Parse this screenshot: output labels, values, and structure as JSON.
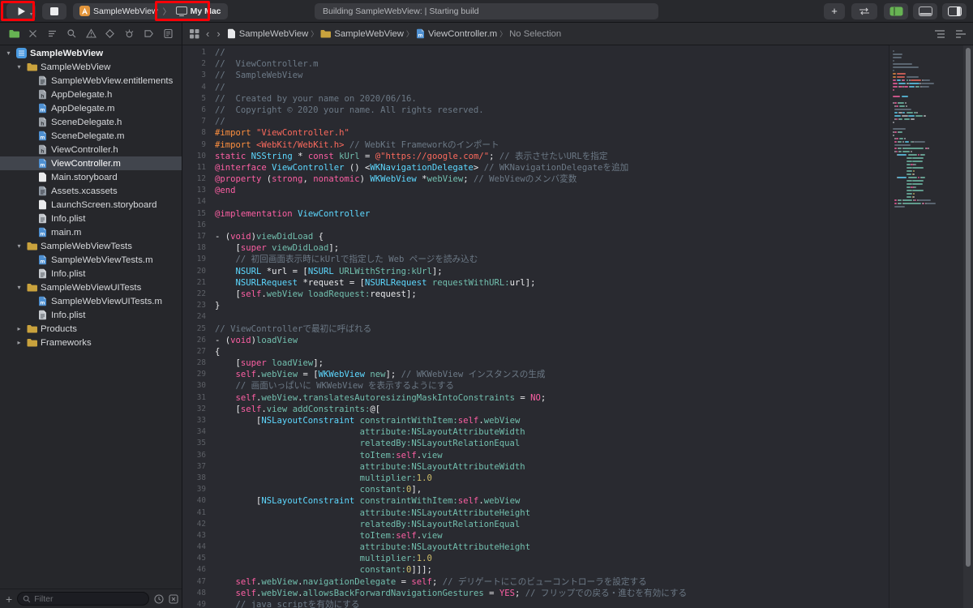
{
  "toolbar": {
    "scheme_app": "SampleWebView",
    "scheme_destination": "My Mac",
    "status": "Building SampleWebView:  | Starting build"
  },
  "jumpbar": {
    "items": [
      {
        "icon": "file-plain",
        "label": "SampleWebView"
      },
      {
        "icon": "folder",
        "label": "SampleWebView"
      },
      {
        "icon": "file-m",
        "label": "ViewController.m"
      },
      {
        "icon": "",
        "label": "No Selection"
      }
    ]
  },
  "sidebar": {
    "nav_icons": [
      "project",
      "source-control",
      "symbols",
      "search",
      "issues",
      "tests",
      "debug",
      "breakpoints",
      "reports"
    ],
    "active_nav": 0,
    "filter_placeholder": "Filter",
    "tree": [
      {
        "level": 0,
        "icon": "project",
        "label": "SampleWebView",
        "expanded": true,
        "bold": true
      },
      {
        "level": 1,
        "icon": "folder",
        "label": "SampleWebView",
        "expanded": true
      },
      {
        "level": 2,
        "icon": "entitlements",
        "label": "SampleWebView.entitlements"
      },
      {
        "level": 2,
        "icon": "file-h",
        "label": "AppDelegate.h"
      },
      {
        "level": 2,
        "icon": "file-m",
        "label": "AppDelegate.m"
      },
      {
        "level": 2,
        "icon": "file-h",
        "label": "SceneDelegate.h"
      },
      {
        "level": 2,
        "icon": "file-m",
        "label": "SceneDelegate.m"
      },
      {
        "level": 2,
        "icon": "file-h",
        "label": "ViewController.h"
      },
      {
        "level": 2,
        "icon": "file-m",
        "label": "ViewController.m",
        "selected": true
      },
      {
        "level": 2,
        "icon": "storyboard",
        "label": "Main.storyboard"
      },
      {
        "level": 2,
        "icon": "xcassets",
        "label": "Assets.xcassets"
      },
      {
        "level": 2,
        "icon": "storyboard",
        "label": "LaunchScreen.storyboard"
      },
      {
        "level": 2,
        "icon": "plist",
        "label": "Info.plist"
      },
      {
        "level": 2,
        "icon": "file-m",
        "label": "main.m"
      },
      {
        "level": 1,
        "icon": "folder",
        "label": "SampleWebViewTests",
        "expanded": true
      },
      {
        "level": 2,
        "icon": "file-m",
        "label": "SampleWebViewTests.m"
      },
      {
        "level": 2,
        "icon": "plist",
        "label": "Info.plist"
      },
      {
        "level": 1,
        "icon": "folder",
        "label": "SampleWebViewUITests",
        "expanded": true
      },
      {
        "level": 2,
        "icon": "file-m",
        "label": "SampleWebViewUITests.m"
      },
      {
        "level": 2,
        "icon": "plist",
        "label": "Info.plist"
      },
      {
        "level": 1,
        "icon": "folder",
        "label": "Products",
        "expanded": false
      },
      {
        "level": 1,
        "icon": "folder",
        "label": "Frameworks",
        "expanded": false
      }
    ]
  },
  "editor": {
    "lines": [
      [
        [
          "c",
          "//"
        ]
      ],
      [
        [
          "c",
          "//  ViewController.m"
        ]
      ],
      [
        [
          "c",
          "//  SampleWebView"
        ]
      ],
      [
        [
          "c",
          "//"
        ]
      ],
      [
        [
          "c",
          "//  Created by your name on 2020/06/16."
        ]
      ],
      [
        [
          "c",
          "//  Copyright © 2020 your name. All rights reserved."
        ]
      ],
      [
        [
          "c",
          "//"
        ]
      ],
      [
        [
          "d",
          "#import "
        ],
        [
          "s",
          "\"ViewController.h\""
        ]
      ],
      [
        [
          "d",
          "#import "
        ],
        [
          "s",
          "<WebKit/WebKit.h>"
        ],
        [
          "p",
          " "
        ],
        [
          "c",
          "// WebKit Frameworkのインポート"
        ]
      ],
      [
        [
          "k",
          "static"
        ],
        [
          "p",
          " "
        ],
        [
          "t",
          "NSString"
        ],
        [
          "p",
          " * "
        ],
        [
          "k",
          "const"
        ],
        [
          "p",
          " "
        ],
        [
          "m",
          "kUrl"
        ],
        [
          "p",
          " = "
        ],
        [
          "s",
          "@\"https://google.com/\""
        ],
        [
          "p",
          "; "
        ],
        [
          "c",
          "// 表示させたいURLを指定"
        ]
      ],
      [
        [
          "k",
          "@interface"
        ],
        [
          "p",
          " "
        ],
        [
          "t",
          "ViewController"
        ],
        [
          "p",
          " () <"
        ],
        [
          "t",
          "WKNavigationDelegate"
        ],
        [
          "p",
          "> "
        ],
        [
          "c",
          "// WKNavigationDelegateを追加"
        ]
      ],
      [
        [
          "k",
          "@property"
        ],
        [
          "p",
          " ("
        ],
        [
          "k",
          "strong"
        ],
        [
          "p",
          ", "
        ],
        [
          "k",
          "nonatomic"
        ],
        [
          "p",
          ") "
        ],
        [
          "t",
          "WKWebView"
        ],
        [
          "p",
          " *"
        ],
        [
          "m",
          "webView"
        ],
        [
          "p",
          "; "
        ],
        [
          "c",
          "// WebViewのメンバ変数"
        ]
      ],
      [
        [
          "k",
          "@end"
        ]
      ],
      [],
      [
        [
          "k",
          "@implementation"
        ],
        [
          "p",
          " "
        ],
        [
          "t",
          "ViewController"
        ]
      ],
      [],
      [
        [
          "p",
          "- ("
        ],
        [
          "k",
          "void"
        ],
        [
          "p",
          ")"
        ],
        [
          "m",
          "viewDidLoad"
        ],
        [
          "p",
          " {"
        ]
      ],
      [
        [
          "p",
          "    ["
        ],
        [
          "k",
          "super"
        ],
        [
          "p",
          " "
        ],
        [
          "m",
          "viewDidLoad"
        ],
        [
          "p",
          "];"
        ]
      ],
      [
        [
          "c",
          "    // 初回画面表示時にkUrlで指定した Web ページを読み込む"
        ]
      ],
      [
        [
          "p",
          "    "
        ],
        [
          "t",
          "NSURL"
        ],
        [
          "p",
          " *url = ["
        ],
        [
          "t",
          "NSURL"
        ],
        [
          "p",
          " "
        ],
        [
          "m",
          "URLWithString:"
        ],
        [
          "m",
          "kUrl"
        ],
        [
          "p",
          "];"
        ]
      ],
      [
        [
          "p",
          "    "
        ],
        [
          "t",
          "NSURLRequest"
        ],
        [
          "p",
          " *request = ["
        ],
        [
          "t",
          "NSURLRequest"
        ],
        [
          "p",
          " "
        ],
        [
          "m",
          "requestWithURL:"
        ],
        [
          "p",
          "url];"
        ]
      ],
      [
        [
          "p",
          "    ["
        ],
        [
          "k",
          "self"
        ],
        [
          "p",
          "."
        ],
        [
          "m",
          "webView"
        ],
        [
          "p",
          " "
        ],
        [
          "m",
          "loadRequest:"
        ],
        [
          "p",
          "request];"
        ]
      ],
      [
        [
          "p",
          "}"
        ]
      ],
      [],
      [
        [
          "c",
          "// ViewControllerで最初に呼ばれる"
        ]
      ],
      [
        [
          "p",
          "- ("
        ],
        [
          "k",
          "void"
        ],
        [
          "p",
          ")"
        ],
        [
          "m",
          "loadView"
        ]
      ],
      [
        [
          "p",
          "{"
        ]
      ],
      [
        [
          "p",
          "    ["
        ],
        [
          "k",
          "super"
        ],
        [
          "p",
          " "
        ],
        [
          "m",
          "loadView"
        ],
        [
          "p",
          "];"
        ]
      ],
      [
        [
          "p",
          "    "
        ],
        [
          "k",
          "self"
        ],
        [
          "p",
          "."
        ],
        [
          "m",
          "webView"
        ],
        [
          "p",
          " = ["
        ],
        [
          "t",
          "WKWebView"
        ],
        [
          "p",
          " "
        ],
        [
          "m",
          "new"
        ],
        [
          "p",
          "]; "
        ],
        [
          "c",
          "// WKWebView インスタンスの生成"
        ]
      ],
      [
        [
          "c",
          "    // 画面いっぱいに WKWebView を表示するようにする"
        ]
      ],
      [
        [
          "p",
          "    "
        ],
        [
          "k",
          "self"
        ],
        [
          "p",
          "."
        ],
        [
          "m",
          "webView"
        ],
        [
          "p",
          "."
        ],
        [
          "m",
          "translatesAutoresizingMaskIntoConstraints"
        ],
        [
          "p",
          " = "
        ],
        [
          "k",
          "NO"
        ],
        [
          "p",
          ";"
        ]
      ],
      [
        [
          "p",
          "    ["
        ],
        [
          "k",
          "self"
        ],
        [
          "p",
          "."
        ],
        [
          "m",
          "view"
        ],
        [
          "p",
          " "
        ],
        [
          "m",
          "addConstraints:"
        ],
        [
          "p",
          "@["
        ]
      ],
      [
        [
          "p",
          "        ["
        ],
        [
          "t",
          "NSLayoutConstraint"
        ],
        [
          "p",
          " "
        ],
        [
          "m",
          "constraintWithItem:"
        ],
        [
          "k",
          "self"
        ],
        [
          "p",
          "."
        ],
        [
          "m",
          "webView"
        ]
      ],
      [
        [
          "p",
          "                            "
        ],
        [
          "m",
          "attribute:"
        ],
        [
          "m",
          "NSLayoutAttributeWidth"
        ]
      ],
      [
        [
          "p",
          "                            "
        ],
        [
          "m",
          "relatedBy:"
        ],
        [
          "m",
          "NSLayoutRelationEqual"
        ]
      ],
      [
        [
          "p",
          "                            "
        ],
        [
          "m",
          "toItem:"
        ],
        [
          "k",
          "self"
        ],
        [
          "p",
          "."
        ],
        [
          "m",
          "view"
        ]
      ],
      [
        [
          "p",
          "                            "
        ],
        [
          "m",
          "attribute:"
        ],
        [
          "m",
          "NSLayoutAttributeWidth"
        ]
      ],
      [
        [
          "p",
          "                            "
        ],
        [
          "m",
          "multiplier:"
        ],
        [
          "n",
          "1.0"
        ]
      ],
      [
        [
          "p",
          "                            "
        ],
        [
          "m",
          "constant:"
        ],
        [
          "n",
          "0"
        ],
        [
          "p",
          "],"
        ]
      ],
      [
        [
          "p",
          "        ["
        ],
        [
          "t",
          "NSLayoutConstraint"
        ],
        [
          "p",
          " "
        ],
        [
          "m",
          "constraintWithItem:"
        ],
        [
          "k",
          "self"
        ],
        [
          "p",
          "."
        ],
        [
          "m",
          "webView"
        ]
      ],
      [
        [
          "p",
          "                            "
        ],
        [
          "m",
          "attribute:"
        ],
        [
          "m",
          "NSLayoutAttributeHeight"
        ]
      ],
      [
        [
          "p",
          "                            "
        ],
        [
          "m",
          "relatedBy:"
        ],
        [
          "m",
          "NSLayoutRelationEqual"
        ]
      ],
      [
        [
          "p",
          "                            "
        ],
        [
          "m",
          "toItem:"
        ],
        [
          "k",
          "self"
        ],
        [
          "p",
          "."
        ],
        [
          "m",
          "view"
        ]
      ],
      [
        [
          "p",
          "                            "
        ],
        [
          "m",
          "attribute:"
        ],
        [
          "m",
          "NSLayoutAttributeHeight"
        ]
      ],
      [
        [
          "p",
          "                            "
        ],
        [
          "m",
          "multiplier:"
        ],
        [
          "n",
          "1.0"
        ]
      ],
      [
        [
          "p",
          "                            "
        ],
        [
          "m",
          "constant:"
        ],
        [
          "n",
          "0"
        ],
        [
          "p",
          "]]];"
        ]
      ],
      [
        [
          "p",
          "    "
        ],
        [
          "k",
          "self"
        ],
        [
          "p",
          "."
        ],
        [
          "m",
          "webView"
        ],
        [
          "p",
          "."
        ],
        [
          "m",
          "navigationDelegate"
        ],
        [
          "p",
          " = "
        ],
        [
          "k",
          "self"
        ],
        [
          "p",
          "; "
        ],
        [
          "c",
          "// デリゲートにこのビューコントローラを設定する"
        ]
      ],
      [
        [
          "p",
          "    "
        ],
        [
          "k",
          "self"
        ],
        [
          "p",
          "."
        ],
        [
          "m",
          "webView"
        ],
        [
          "p",
          "."
        ],
        [
          "m",
          "allowsBackForwardNavigationGestures"
        ],
        [
          "p",
          " = "
        ],
        [
          "k",
          "YES"
        ],
        [
          "p",
          "; "
        ],
        [
          "c",
          "// フリップでの戻る・進むを有効にする"
        ]
      ],
      [
        [
          "c",
          "    // java scriptを有効にする"
        ]
      ]
    ]
  }
}
